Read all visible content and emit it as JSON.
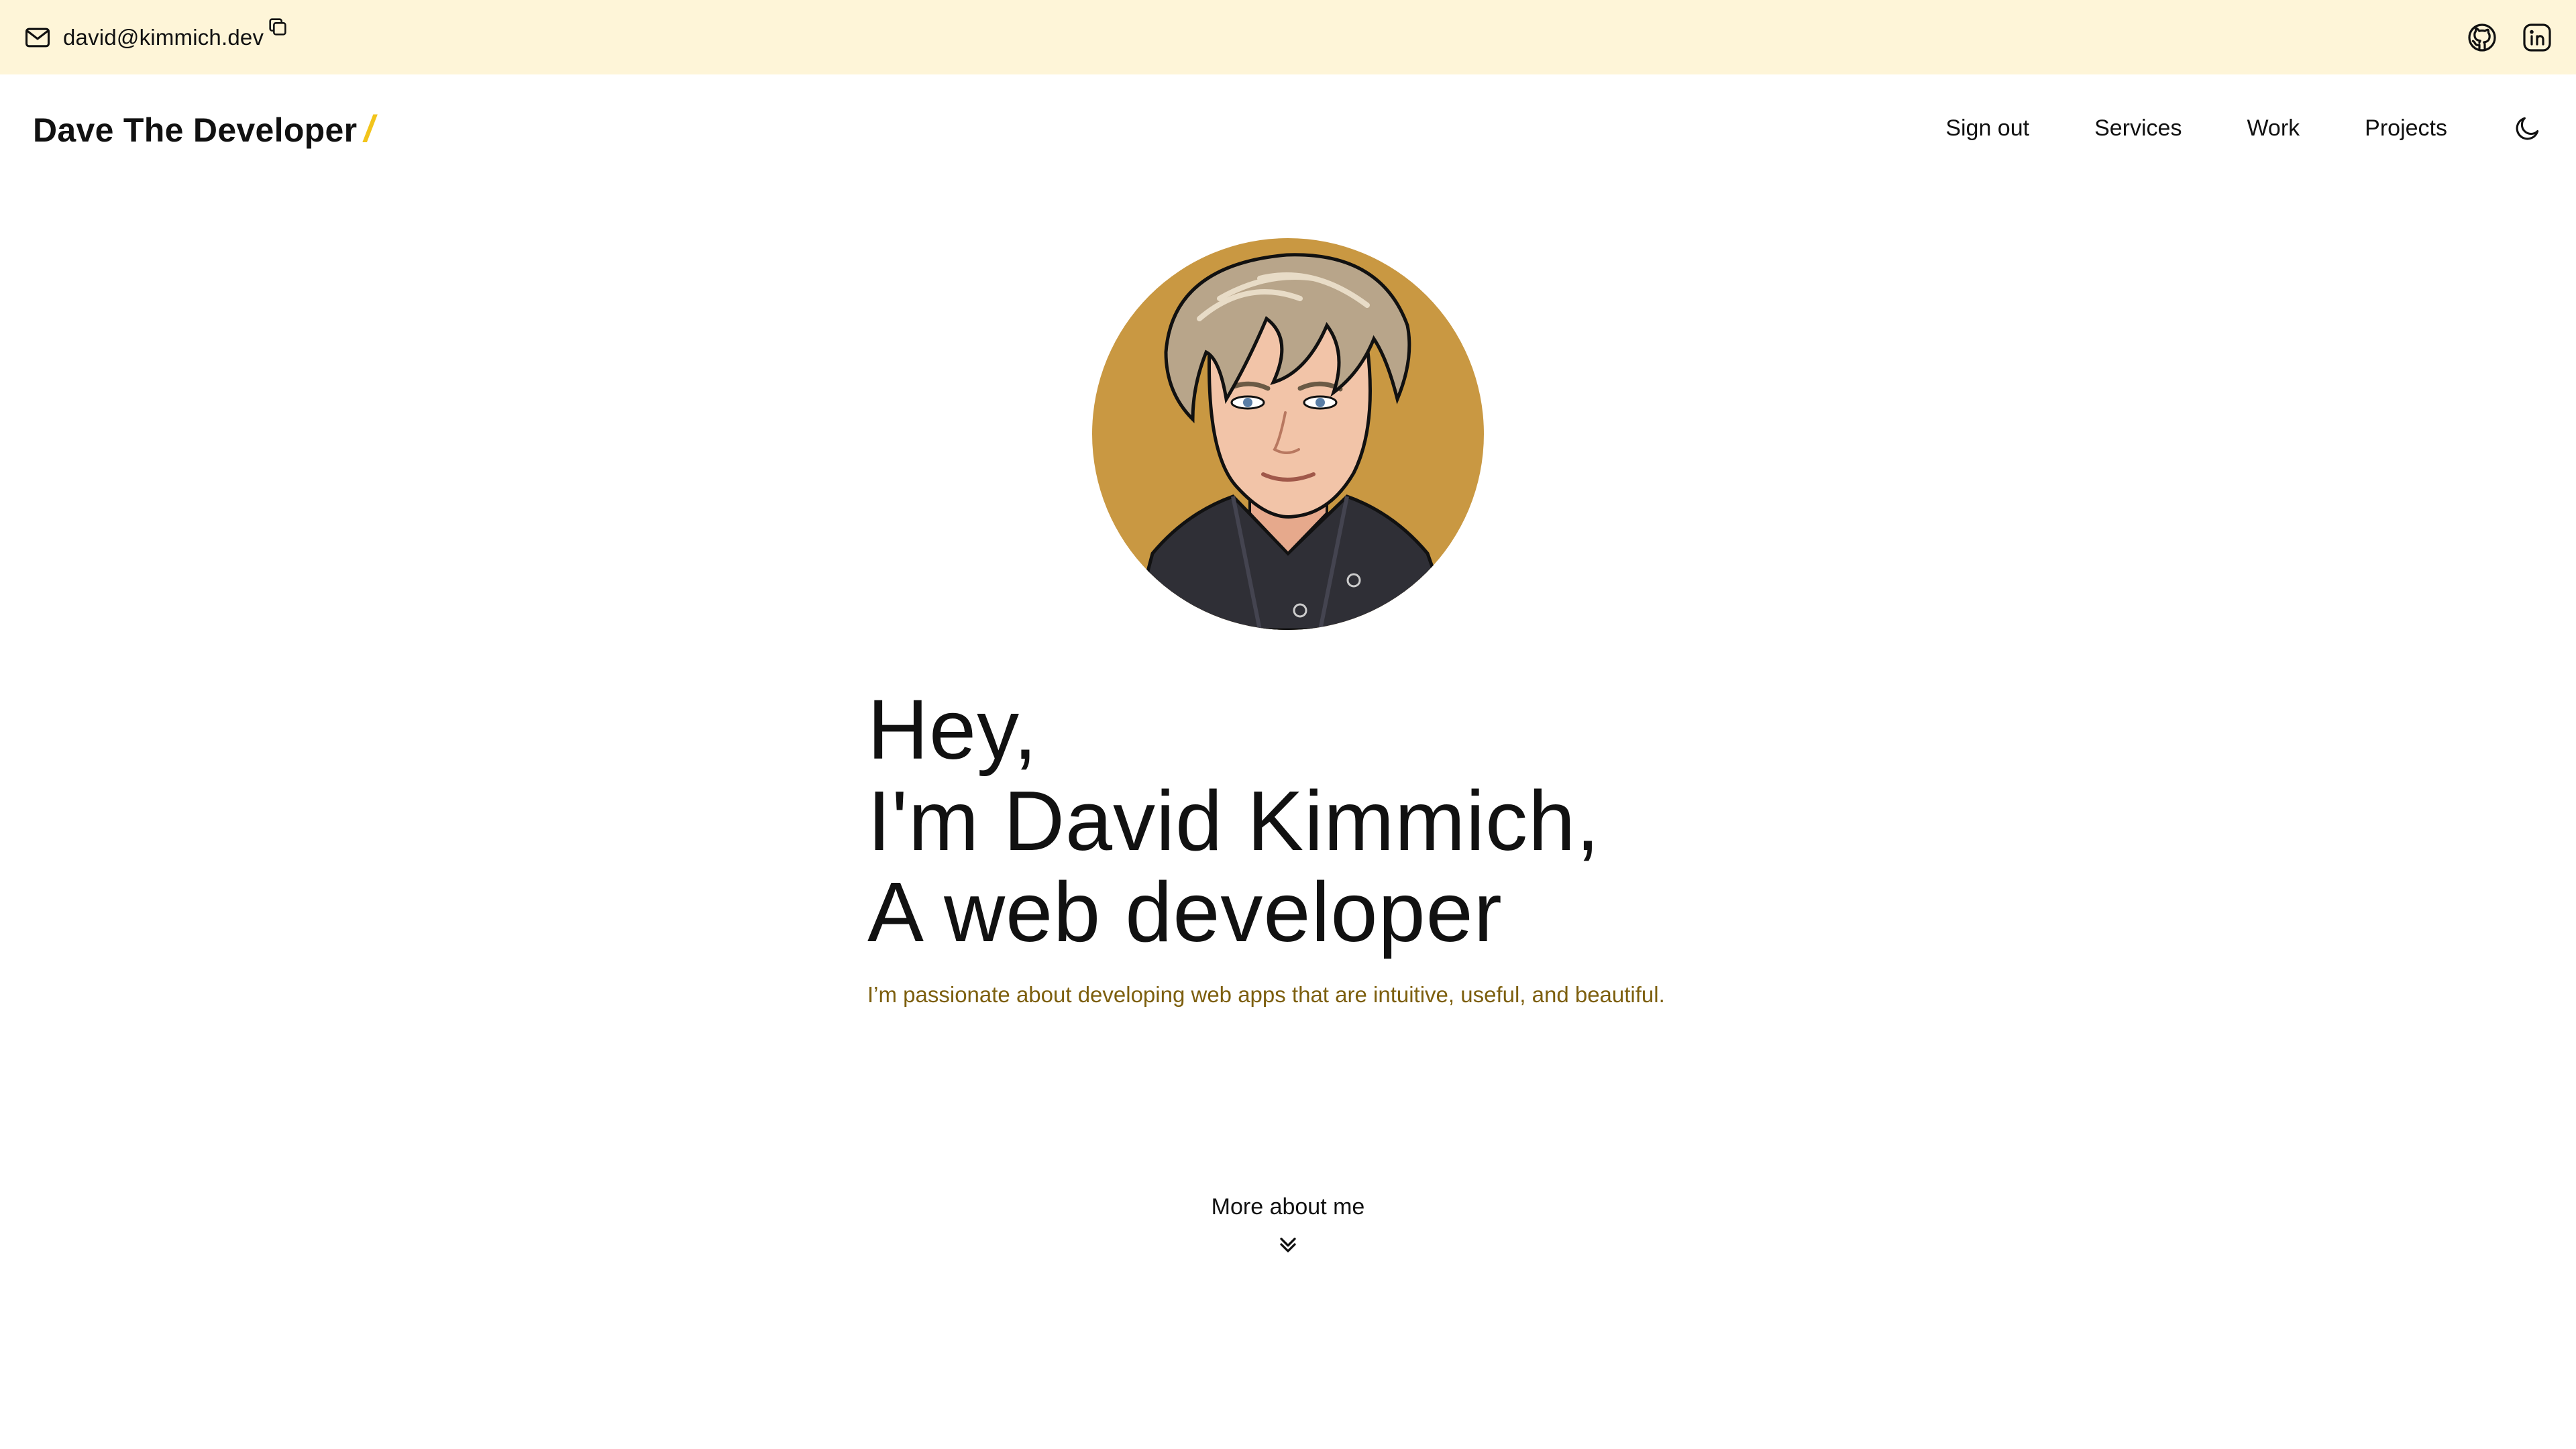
{
  "topbar": {
    "email": "david@kimmich.dev",
    "icons": {
      "mail": "mail-icon",
      "copy": "copy-icon",
      "github": "github-icon",
      "linkedin": "linkedin-icon"
    }
  },
  "navbar": {
    "brand": "Dave The Developer",
    "brand_mark": "/",
    "links": [
      {
        "label": "Sign out"
      },
      {
        "label": "Services"
      },
      {
        "label": "Work"
      },
      {
        "label": "Projects"
      }
    ],
    "theme_icon": "moon-icon"
  },
  "hero": {
    "line1": "Hey,",
    "line2": "I'm David Kimmich,",
    "line3": "A web developer",
    "tagline": "I’m passionate about developing web apps that are intuitive, useful, and beautiful."
  },
  "more": {
    "label": "More about me",
    "icon": "chevrons-down-icon"
  },
  "colors": {
    "topbar_bg": "#fef5d8",
    "accent": "#f2c41b",
    "tagline": "#7d5f0e",
    "avatar_bg": "#c99842"
  }
}
